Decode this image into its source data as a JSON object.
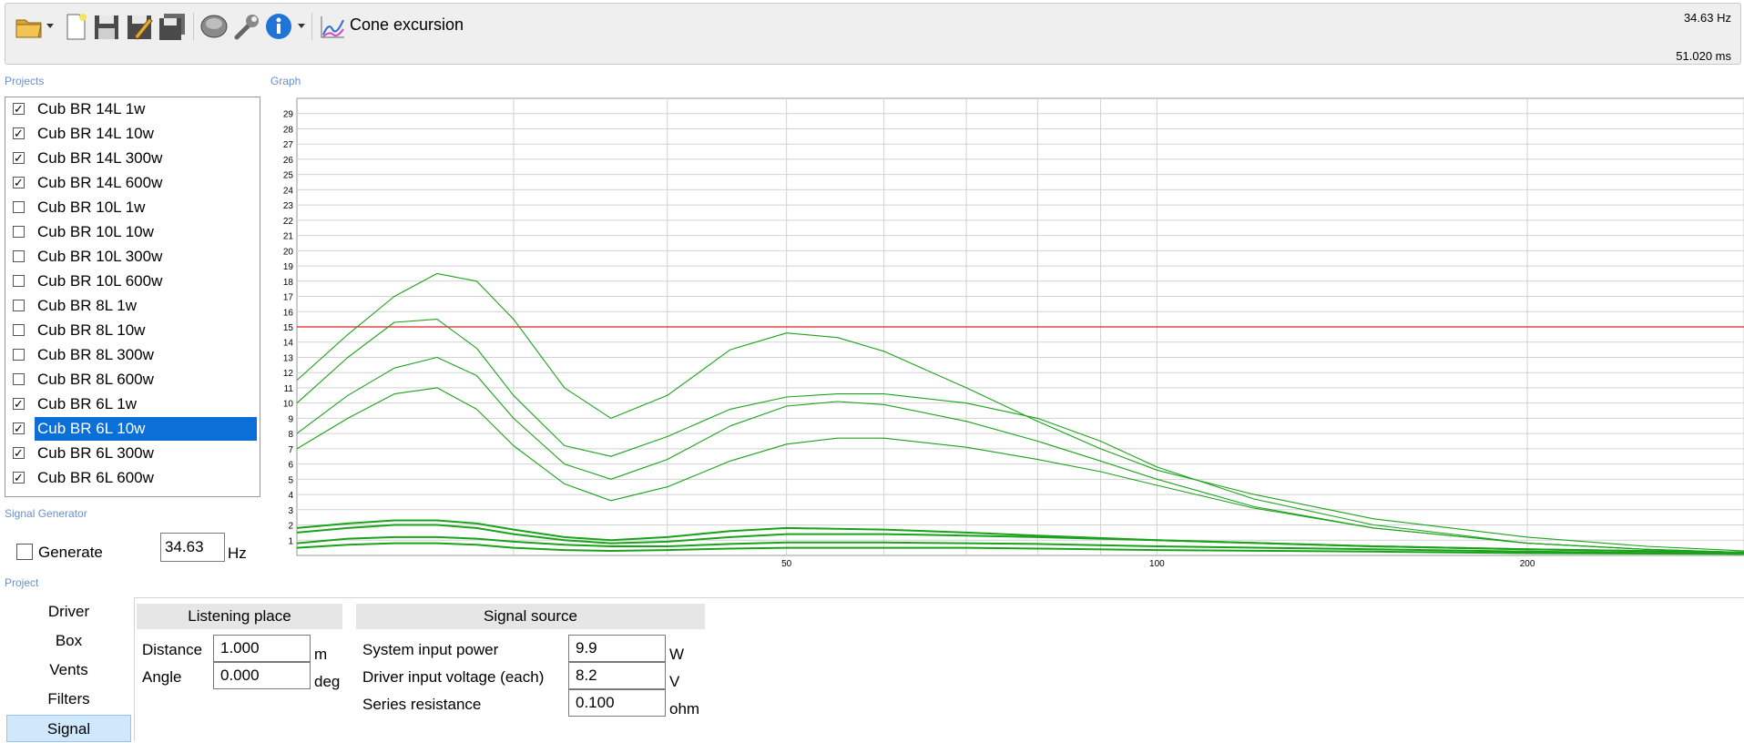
{
  "toolbar": {
    "title": "Cone excursion",
    "frequency_readout": "34.63 Hz",
    "time_readout": "51.020 ms",
    "icons": [
      "open-folder-icon",
      "dropdown-arrow-icon",
      "new-file-icon",
      "save-icon",
      "save-as-icon",
      "save-all-icon",
      "speaker-icon",
      "settings-wrench-icon",
      "info-icon",
      "dropdown-arrow-icon",
      "chart-icon"
    ]
  },
  "sections": {
    "projects": "Projects",
    "graph": "Graph",
    "signal_generator": "Signal Generator",
    "project": "Project"
  },
  "projects": [
    {
      "label": "Cub BR 14L 1w",
      "checked": true
    },
    {
      "label": "Cub BR 14L 10w",
      "checked": true
    },
    {
      "label": "Cub BR 14L 300w",
      "checked": true
    },
    {
      "label": "Cub BR 14L 600w",
      "checked": true
    },
    {
      "label": "Cub BR 10L 1w",
      "checked": false
    },
    {
      "label": "Cub BR 10L 10w",
      "checked": false
    },
    {
      "label": "Cub BR 10L 300w",
      "checked": false
    },
    {
      "label": "Cub BR 10L 600w",
      "checked": false
    },
    {
      "label": "Cub BR 8L 1w",
      "checked": false
    },
    {
      "label": "Cub BR 8L 10w",
      "checked": false
    },
    {
      "label": "Cub BR 8L 300w",
      "checked": false
    },
    {
      "label": "Cub BR 8L 600w",
      "checked": false
    },
    {
      "label": "Cub BR 6L 1w",
      "checked": true
    },
    {
      "label": "Cub BR 6L 10w",
      "checked": true,
      "selected": true
    },
    {
      "label": "Cub BR 6L 300w",
      "checked": true
    },
    {
      "label": "Cub BR 6L 600w",
      "checked": true
    }
  ],
  "signal_generator": {
    "generate_label": "Generate",
    "generate_checked": false,
    "frequency_value": "34.63",
    "frequency_unit": "Hz"
  },
  "chart_data": {
    "type": "line",
    "xscale": "log",
    "xlim": [
      20,
      300
    ],
    "ylim": [
      0,
      30
    ],
    "yticks": [
      1,
      2,
      3,
      4,
      5,
      6,
      7,
      8,
      9,
      10,
      11,
      12,
      13,
      14,
      15,
      16,
      17,
      18,
      19,
      20,
      21,
      22,
      23,
      24,
      25,
      26,
      27,
      28,
      29
    ],
    "xticks": [
      {
        "value": 50,
        "label": "50"
      },
      {
        "value": 100,
        "label": "100"
      },
      {
        "value": 200,
        "label": "200"
      }
    ],
    "xgrid": [
      30,
      40,
      50,
      60,
      70,
      80,
      90,
      100,
      200,
      300
    ],
    "limit_line": {
      "y": 15,
      "color": "#e02020"
    },
    "series_color": "#1aa31a",
    "series": [
      {
        "x": [
          20,
          22,
          24,
          26,
          28,
          30,
          33,
          36,
          40,
          45,
          50,
          55,
          60,
          70,
          80,
          90,
          100,
          120,
          150,
          200,
          250,
          300
        ],
        "y": [
          11.5,
          14.5,
          17,
          18.5,
          18,
          15.5,
          11,
          9,
          10.5,
          13.5,
          14.6,
          14.3,
          13.4,
          11,
          8.8,
          7,
          5.6,
          4,
          2.4,
          1.2,
          0.6,
          0.3
        ]
      },
      {
        "x": [
          20,
          22,
          24,
          26,
          28,
          30,
          33,
          36,
          40,
          45,
          50,
          55,
          60,
          70,
          80,
          90,
          100,
          120,
          150,
          200,
          250,
          300
        ],
        "y": [
          10,
          13,
          15.3,
          15.5,
          13.6,
          10.5,
          7.2,
          6.5,
          7.8,
          9.6,
          10.4,
          10.6,
          10.6,
          10,
          9,
          7.5,
          5.8,
          3.7,
          2,
          0.8,
          0.4,
          0.2
        ]
      },
      {
        "x": [
          20,
          22,
          24,
          26,
          28,
          30,
          33,
          36,
          40,
          45,
          50,
          55,
          60,
          70,
          80,
          90,
          100,
          120,
          150,
          200,
          250,
          300
        ],
        "y": [
          8,
          10.5,
          12.3,
          13,
          11.8,
          9,
          6,
          5,
          6.3,
          8.5,
          9.8,
          10.1,
          9.9,
          8.8,
          7.5,
          6.2,
          5,
          3.2,
          1.8,
          0.8,
          0.4,
          0.2
        ]
      },
      {
        "x": [
          20,
          22,
          24,
          26,
          28,
          30,
          33,
          36,
          40,
          45,
          50,
          55,
          60,
          70,
          80,
          90,
          100,
          120,
          150,
          200,
          250,
          300
        ],
        "y": [
          7,
          9,
          10.6,
          11,
          9.6,
          7.2,
          4.7,
          3.6,
          4.5,
          6.2,
          7.3,
          7.7,
          7.7,
          7.1,
          6.3,
          5.5,
          4.6,
          3.1,
          1.8,
          0.8,
          0.4,
          0.2
        ]
      },
      {
        "x": [
          20,
          22,
          24,
          26,
          28,
          30,
          33,
          36,
          40,
          45,
          50,
          60,
          70,
          80,
          100,
          150,
          200,
          300
        ],
        "y": [
          1.8,
          2.1,
          2.3,
          2.3,
          2.1,
          1.7,
          1.2,
          1,
          1.2,
          1.6,
          1.8,
          1.7,
          1.5,
          1.3,
          1,
          0.6,
          0.4,
          0.2
        ]
      },
      {
        "x": [
          20,
          22,
          24,
          26,
          28,
          30,
          33,
          36,
          40,
          45,
          50,
          60,
          70,
          80,
          100,
          150,
          200,
          300
        ],
        "y": [
          1.5,
          1.8,
          2,
          2,
          1.8,
          1.4,
          1,
          0.8,
          0.9,
          1.2,
          1.4,
          1.4,
          1.3,
          1.2,
          1,
          0.6,
          0.4,
          0.2
        ]
      },
      {
        "x": [
          20,
          22,
          24,
          26,
          28,
          30,
          33,
          36,
          40,
          45,
          50,
          60,
          70,
          80,
          100,
          150,
          200,
          300
        ],
        "y": [
          0.8,
          1.1,
          1.2,
          1.2,
          1.1,
          0.9,
          0.7,
          0.6,
          0.6,
          0.75,
          0.85,
          0.85,
          0.8,
          0.75,
          0.6,
          0.4,
          0.25,
          0.1
        ]
      },
      {
        "x": [
          20,
          22,
          24,
          26,
          28,
          30,
          33,
          36,
          40,
          45,
          50,
          60,
          70,
          80,
          100,
          150,
          200,
          300
        ],
        "y": [
          0.5,
          0.7,
          0.8,
          0.8,
          0.7,
          0.5,
          0.35,
          0.3,
          0.35,
          0.45,
          0.5,
          0.5,
          0.5,
          0.45,
          0.35,
          0.25,
          0.15,
          0.1
        ]
      }
    ]
  },
  "project_nav": [
    {
      "label": "Driver",
      "active": false
    },
    {
      "label": "Box",
      "active": false
    },
    {
      "label": "Vents",
      "active": false
    },
    {
      "label": "Filters",
      "active": false
    },
    {
      "label": "Signal",
      "active": true
    }
  ],
  "listening_place": {
    "title": "Listening place",
    "distance_label": "Distance",
    "distance_value": "1.000",
    "distance_unit": "m",
    "angle_label": "Angle",
    "angle_value": "0.000",
    "angle_unit": "deg"
  },
  "signal_source": {
    "title": "Signal source",
    "power_label": "System input power",
    "power_value": "9.9",
    "power_unit": "W",
    "voltage_label": "Driver input voltage (each)",
    "voltage_value": "8.2",
    "voltage_unit": "V",
    "resistance_label": "Series resistance",
    "resistance_value": "0.100",
    "resistance_unit": "ohm"
  }
}
